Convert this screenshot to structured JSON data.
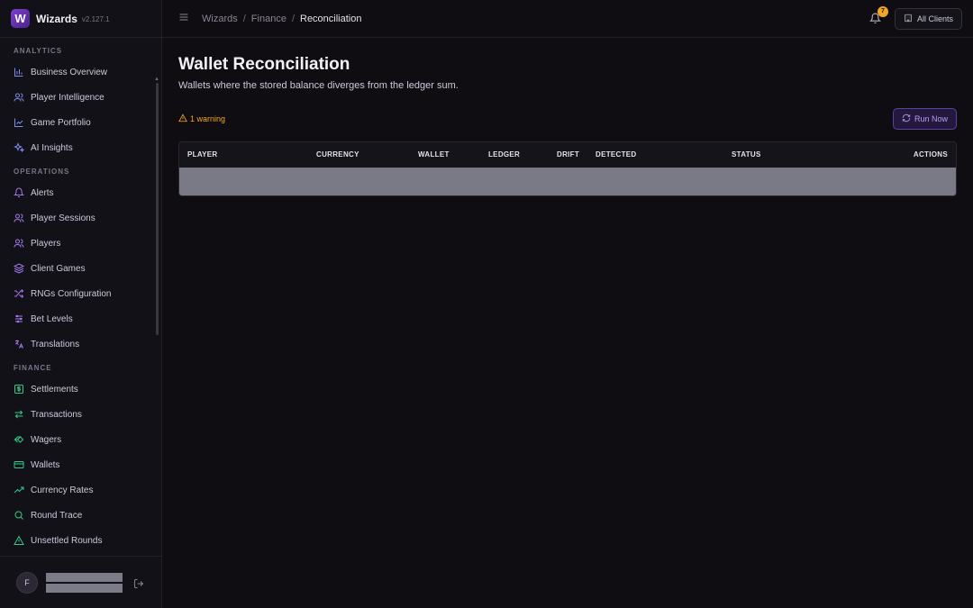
{
  "app": {
    "name": "Wizards",
    "version": "v2.127.1",
    "logo_letter": "W"
  },
  "sidebar": {
    "sections": [
      {
        "label": "ANALYTICS",
        "items": [
          {
            "label": "Business Overview",
            "icon": "bar-chart-icon"
          },
          {
            "label": "Player Intelligence",
            "icon": "users-icon"
          },
          {
            "label": "Game Portfolio",
            "icon": "line-chart-icon"
          },
          {
            "label": "AI Insights",
            "icon": "sparkles-icon"
          }
        ]
      },
      {
        "label": "OPERATIONS",
        "items": [
          {
            "label": "Alerts",
            "icon": "bell-icon"
          },
          {
            "label": "Player Sessions",
            "icon": "users-icon"
          },
          {
            "label": "Players",
            "icon": "users-icon"
          },
          {
            "label": "Client Games",
            "icon": "layers-icon"
          },
          {
            "label": "RNGs Configuration",
            "icon": "shuffle-icon"
          },
          {
            "label": "Bet Levels",
            "icon": "sliders-icon"
          },
          {
            "label": "Translations",
            "icon": "languages-icon"
          }
        ]
      },
      {
        "label": "FINANCE",
        "items": [
          {
            "label": "Settlements",
            "icon": "dollar-icon"
          },
          {
            "label": "Transactions",
            "icon": "arrows-icon"
          },
          {
            "label": "Wagers",
            "icon": "coins-icon"
          },
          {
            "label": "Wallets",
            "icon": "wallet-icon"
          },
          {
            "label": "Currency Rates",
            "icon": "trending-up-icon"
          },
          {
            "label": "Round Trace",
            "icon": "search-icon"
          },
          {
            "label": "Unsettled Rounds",
            "icon": "alert-triangle-icon"
          }
        ]
      }
    ],
    "user": {
      "initial": "F"
    }
  },
  "topbar": {
    "breadcrumb": [
      "Wizards",
      "Finance",
      "Reconciliation"
    ],
    "notification_count": "7",
    "clients_label": "All Clients"
  },
  "page": {
    "title": "Wallet Reconciliation",
    "subtitle": "Wallets where the stored balance diverges from the ledger sum.",
    "warning": "1 warning",
    "run_label": "Run Now"
  },
  "table": {
    "columns": [
      "PLAYER",
      "CURRENCY",
      "WALLET",
      "LEDGER",
      "DRIFT",
      "DETECTED",
      "STATUS",
      "ACTIONS"
    ]
  },
  "colors": {
    "accent": "#7b3fc8",
    "warning": "#f0a623",
    "finance": "#2fc98a",
    "analytics": "#7f8cf0"
  }
}
